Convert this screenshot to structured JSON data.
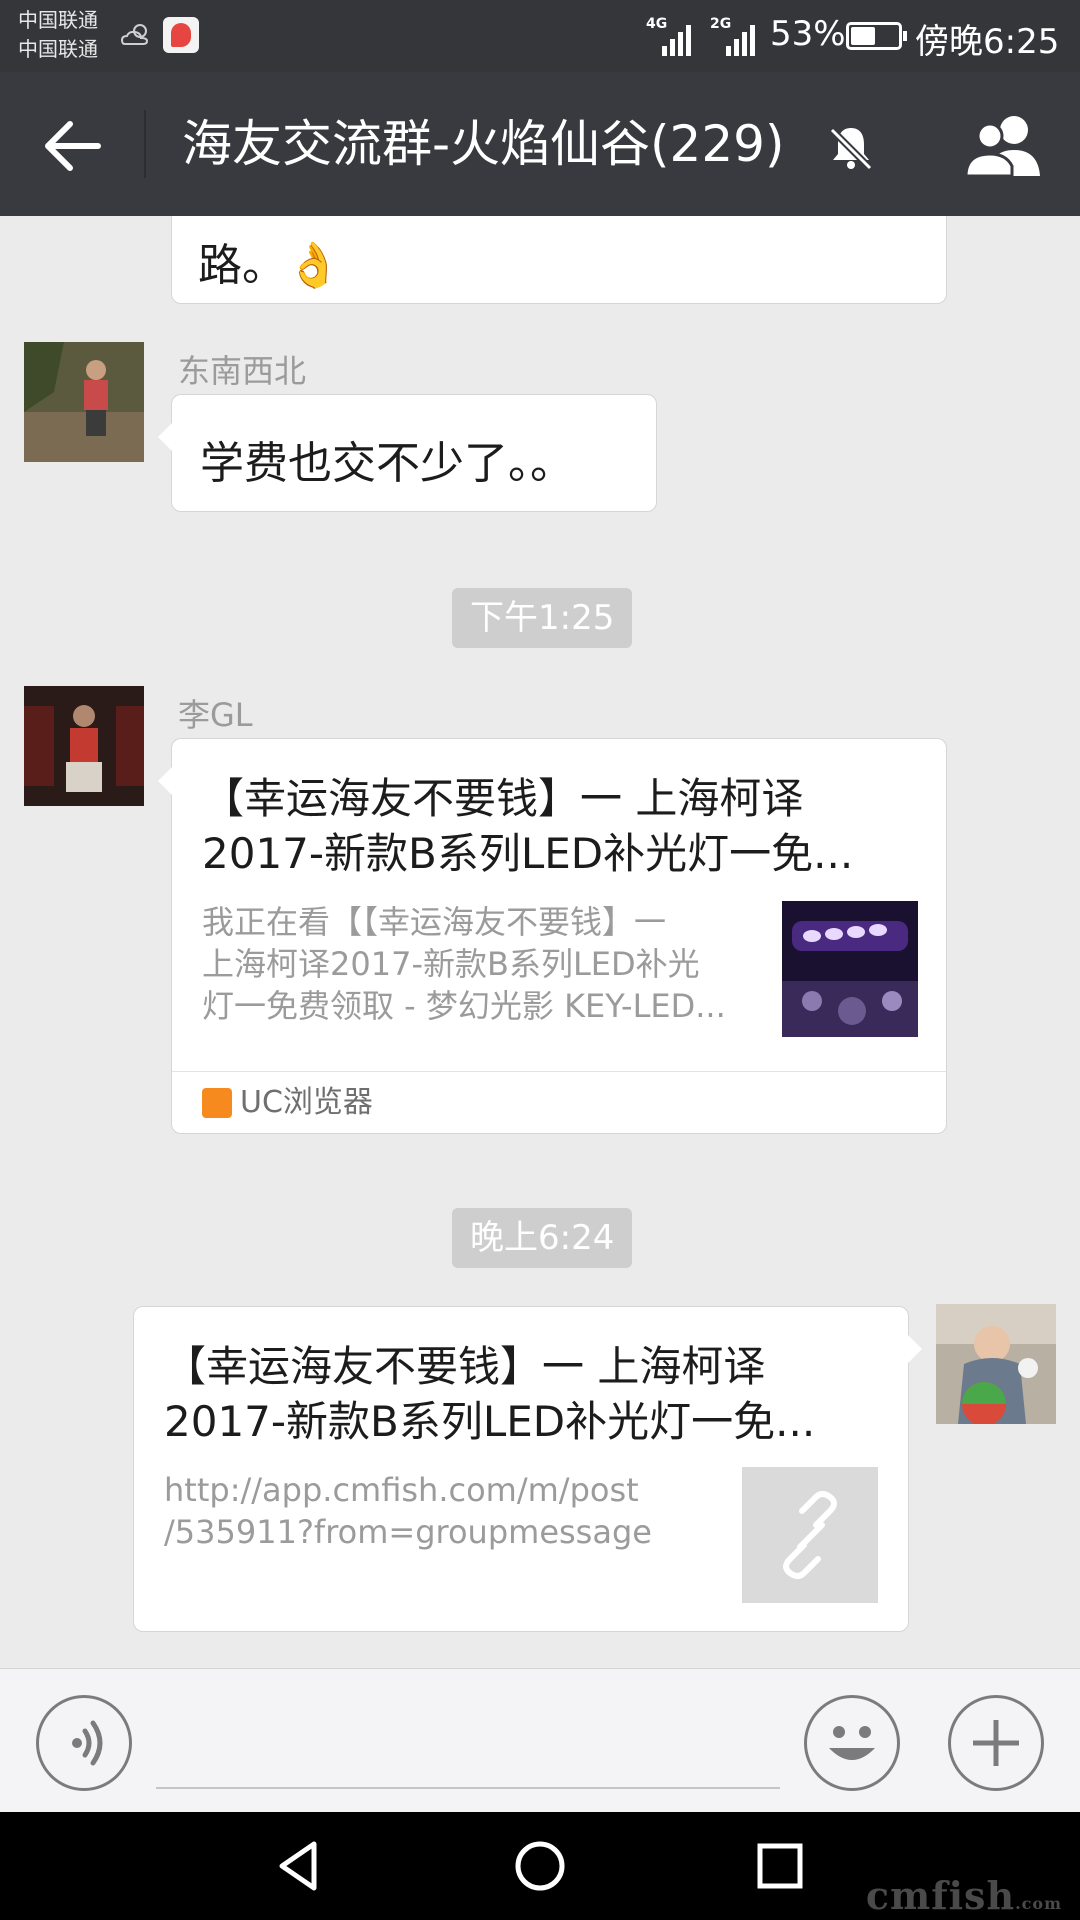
{
  "status_bar": {
    "carrier_1": "中国联通",
    "carrier_2": "中国联通",
    "network_1": "4G",
    "network_2": "2G",
    "battery_percent": "53%",
    "battery_level": 0.53,
    "time": "傍晚6:25"
  },
  "header": {
    "title": "海友交流群-火焰仙谷(229)",
    "muted": true
  },
  "messages": [
    {
      "type": "text",
      "direction": "incoming",
      "text": "路。👌",
      "partial": true
    },
    {
      "type": "text",
      "direction": "incoming",
      "sender": "东南西北",
      "text": "学费也交不少了。。"
    },
    {
      "type": "timestamp",
      "text": "下午1:25"
    },
    {
      "type": "link",
      "direction": "incoming",
      "sender": "李GL",
      "title": "【幸运海友不要钱】一 上海柯译2017-新款B系列LED补光灯一免...",
      "title_line1": "【幸运海友不要钱】一 上海柯译",
      "title_line2": "2017-新款B系列LED补光灯一免...",
      "description_lines": [
        "我正在看【【幸运海友不要钱】一",
        "上海柯译2017-新款B系列LED补光",
        "灯一免费领取 - 梦幻光影 KEY-LED..."
      ],
      "source": "UC浏览器"
    },
    {
      "type": "timestamp",
      "text": "晚上6:24"
    },
    {
      "type": "link",
      "direction": "outgoing",
      "title_line1": "【幸运海友不要钱】一 上海柯译",
      "title_line2": "2017-新款B系列LED补光灯一免...",
      "description_lines": [
        "http://app.cmfish.com/m/post",
        "/535911?from=groupmessage"
      ]
    }
  ],
  "input_bar": {
    "voice_icon": "voice-icon",
    "emoji_icon": "emoji-icon",
    "plus_icon": "plus-icon"
  },
  "watermark": {
    "main": "cmfish",
    "suffix": ".com"
  },
  "colors": {
    "title_bar": "#393a3f",
    "status_bar": "#35363a",
    "chat_background": "#ebebeb",
    "timestamp_bg": "#cecece"
  }
}
